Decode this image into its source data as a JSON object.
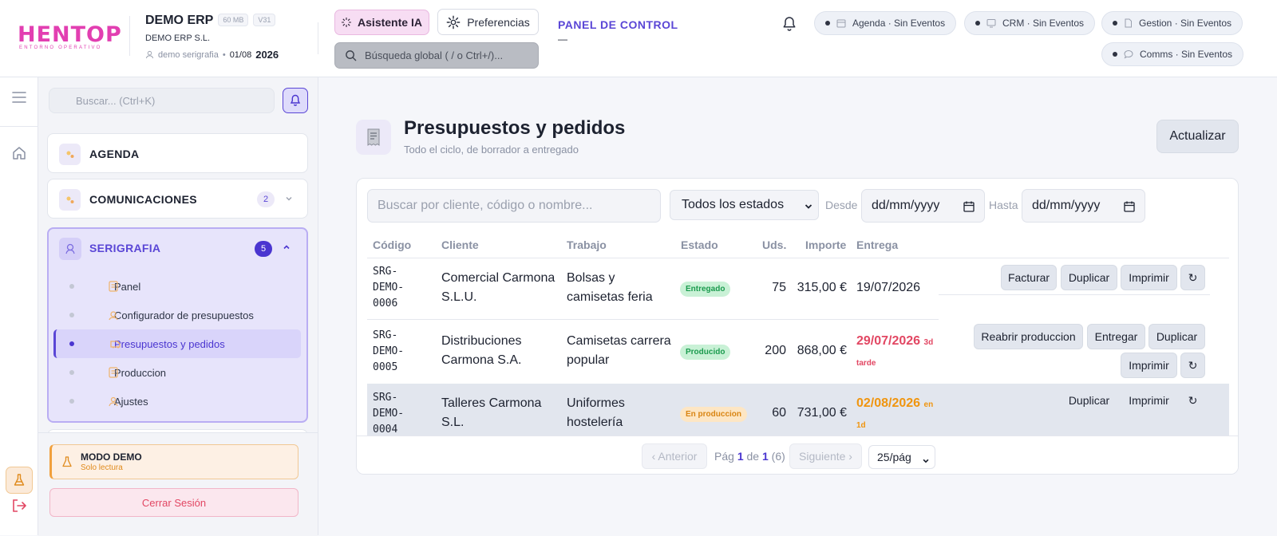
{
  "header": {
    "logo_text": "HENTOP",
    "logo_sub": "ENTORNO OPERATIVO",
    "company_name": "DEMO ERP",
    "storage_badge": "60 MB",
    "version_badge": "V31",
    "company_legal": "DEMO ERP S.L.",
    "user": "demo serigrafia",
    "date": "01/08",
    "year": "2026",
    "ai_button": "Asistente IA",
    "prefs_button": "Preferencias",
    "search_placeholder": "Búsqueda global ( / o Ctrl+/)...",
    "panel_title": "PANEL DE CONTROL",
    "panel_dash": "—",
    "events": [
      "Agenda · Sin Eventos",
      "CRM · Sin Eventos",
      "Gestion · Sin Eventos",
      "Comms · Sin Eventos"
    ]
  },
  "sidebar": {
    "search_placeholder": "Buscar... (Ctrl+K)",
    "sections": [
      {
        "label": "AGENDA"
      },
      {
        "label": "COMUNICACIONES",
        "count": "2"
      },
      {
        "label": "SERIGRAFIA",
        "count": "5"
      }
    ],
    "sub_items": [
      {
        "label": "Panel"
      },
      {
        "label": "Configurador de presupuestos"
      },
      {
        "label": "Presupuestos y pedidos"
      },
      {
        "label": "Produccion"
      },
      {
        "label": "Ajustes"
      }
    ],
    "demo_title": "MODO DEMO",
    "demo_sub": "Solo lectura",
    "logout": "Cerrar Sesión"
  },
  "page": {
    "title": "Presupuestos y pedidos",
    "subtitle": "Todo el ciclo, de borrador a entregado",
    "refresh": "Actualizar"
  },
  "filters": {
    "search_placeholder": "Buscar por cliente, código o nombre...",
    "status_selected": "Todos los estados",
    "from_label": "Desde",
    "to_label": "Hasta",
    "date_placeholder": "dd/mm/yyyy"
  },
  "table": {
    "headers": [
      "Código",
      "Cliente",
      "Trabajo",
      "Estado",
      "Uds.",
      "Importe",
      "Entrega"
    ],
    "rows": [
      {
        "code": [
          "SRG-",
          "DEMO-",
          "0006"
        ],
        "client": [
          "Comercial Carmona",
          "S.L.U."
        ],
        "job": [
          "Bolsas y",
          "camisetas feria"
        ],
        "status": "Entregado",
        "units": "75",
        "amount": "315,00 €",
        "delivery": "19/07/2026",
        "delivery_note": "",
        "actions": [
          "Facturar",
          "Duplicar",
          "Imprimir",
          "↻"
        ]
      },
      {
        "code": [
          "SRG-",
          "DEMO-",
          "0005"
        ],
        "client": [
          "Distribuciones",
          "Carmona S.A."
        ],
        "job": [
          "Camisetas carrera",
          "popular"
        ],
        "status": "Producido",
        "units": "200",
        "amount": "868,00 €",
        "delivery": "29/07/2026",
        "delivery_note": "3d tarde",
        "actions": [
          "Reabrir produccion",
          "Entregar",
          "Duplicar",
          "Imprimir",
          "↻"
        ]
      },
      {
        "code": [
          "SRG-",
          "DEMO-",
          "0004"
        ],
        "client": [
          "Talleres Carmona",
          "S.L."
        ],
        "job": [
          "Uniformes",
          "hostelería"
        ],
        "status": "En produccion",
        "units": "60",
        "amount": "731,00 €",
        "delivery": "02/08/2026",
        "delivery_note": "en 1d",
        "actions": [
          "Duplicar",
          "Imprimir",
          "↻"
        ]
      }
    ]
  },
  "pagination": {
    "prev": "‹ Anterior",
    "pag_label": "Pág",
    "page": "1",
    "of_label": "de",
    "total_pages": "1",
    "total": "(6)",
    "next": "Siguiente ›",
    "page_size": "25/pág"
  },
  "colors": {
    "accent": "#5a46d6",
    "brand": "#e23fb1",
    "success": "#1b9b4e",
    "danger": "#e24763",
    "warning": "#f0950f"
  }
}
